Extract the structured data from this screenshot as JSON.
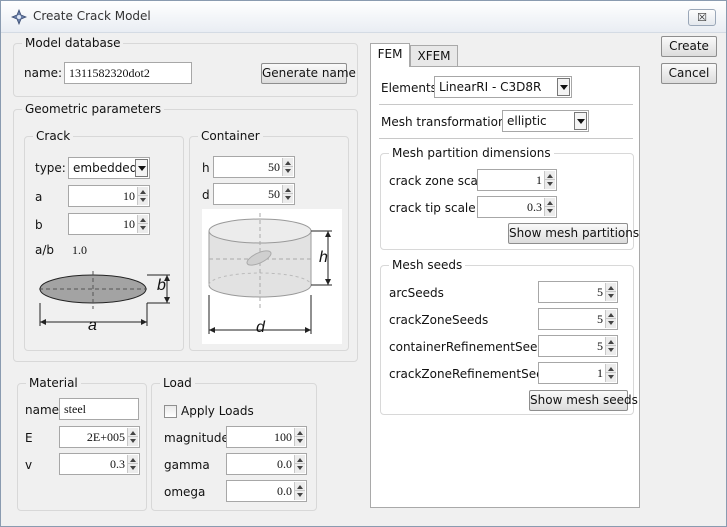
{
  "window": {
    "title": "Create Crack Model",
    "close_label": "☒"
  },
  "model_database": {
    "legend": "Model database",
    "name_label": "name:",
    "name_value": "1311582320dot2",
    "generate_button": "Generate name"
  },
  "geometric": {
    "legend": "Geometric parameters",
    "crack": {
      "legend": "Crack",
      "type_label": "type:",
      "type_value": "embedded",
      "a_label": "a",
      "a_value": "10",
      "b_label": "b",
      "b_value": "10",
      "ab_label": "a/b",
      "ab_value": "1.0",
      "diagram_a": "a",
      "diagram_b": "b"
    },
    "container": {
      "legend": "Container",
      "h_label": "h",
      "h_value": "50",
      "d_label": "d",
      "d_value": "50",
      "diagram_h": "h",
      "diagram_d": "d"
    }
  },
  "material": {
    "legend": "Material",
    "name_label": "name",
    "name_value": "steel",
    "e_label": "E",
    "e_value": "2E+005",
    "v_label": "v",
    "v_value": "0.3"
  },
  "load": {
    "legend": "Load",
    "apply_label": "Apply Loads",
    "magnitude_label": "magnitude",
    "magnitude_value": "100",
    "gamma_label": "gamma",
    "gamma_value": "0.0",
    "omega_label": "omega",
    "omega_value": "0.0"
  },
  "tabs": {
    "fem": "FEM",
    "xfem": "XFEM"
  },
  "fem": {
    "elements_label": "Elements",
    "elements_value": "LinearRI - C3D8R",
    "mesh_transform_label": "Mesh transformation:",
    "mesh_transform_value": "elliptic",
    "partition": {
      "legend": "Mesh partition dimensions",
      "crack_zone_label": "crack zone scale",
      "crack_zone_value": "1",
      "crack_tip_label": "crack tip scale",
      "crack_tip_value": "0.3",
      "show_button": "Show mesh partitions"
    },
    "seeds": {
      "legend": "Mesh seeds",
      "arc_label": "arcSeeds",
      "arc_value": "5",
      "crackzone_label": "crackZoneSeeds",
      "crackzone_value": "5",
      "container_ref_label": "containerRefinementSeeds",
      "container_ref_value": "5",
      "crackzone_ref_label": "crackZoneRefinementSeeds",
      "crackzone_ref_value": "1",
      "show_button": "Show mesh seeds"
    }
  },
  "actions": {
    "create": "Create",
    "cancel": "Cancel"
  }
}
